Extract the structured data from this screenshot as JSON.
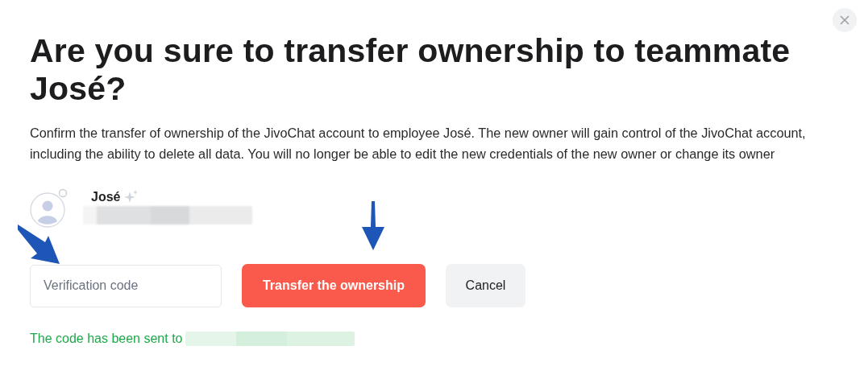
{
  "title": "Are you sure to transfer ownership to teammate José?",
  "description": "Confirm the transfer of ownership of the JivoChat account to employee José. The new owner will gain control of the JivoChat account, including the ability to delete all data. You will no longer be able to edit the new credentials of the new owner or change its owner",
  "user": {
    "name": "José"
  },
  "code_field": {
    "placeholder": "Verification code"
  },
  "buttons": [
    {
      "label": "Transfer the ownership",
      "kind": "primary"
    },
    {
      "label": "Cancel",
      "kind": "secondary"
    }
  ],
  "notice": "The code has been sent to"
}
